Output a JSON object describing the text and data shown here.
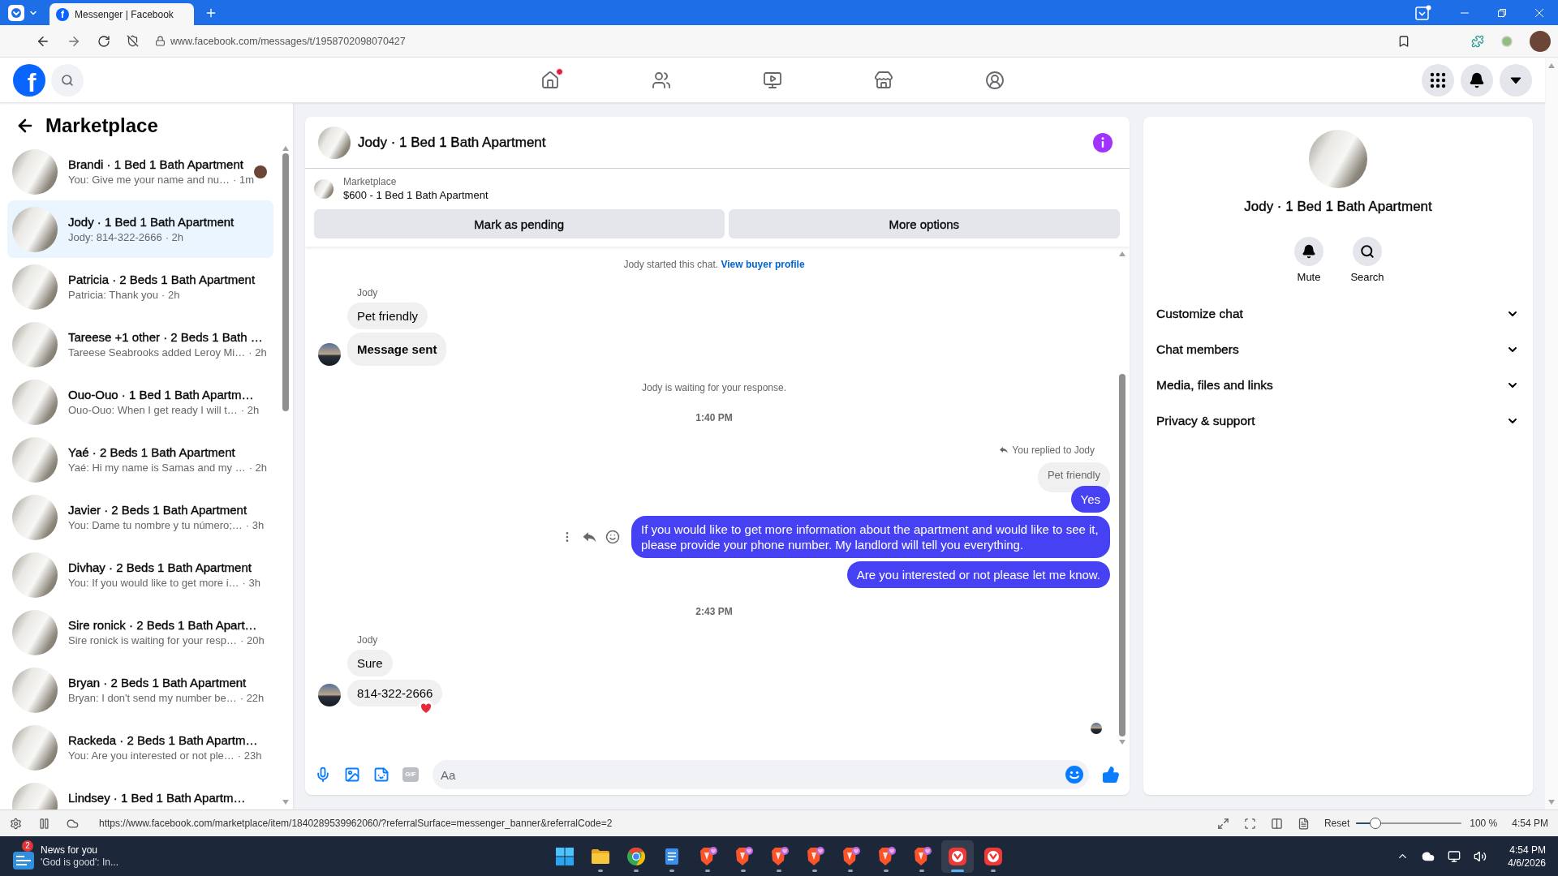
{
  "browser": {
    "tabs": [
      {
        "favicon": "f",
        "title": "Messenger | Facebook",
        "selected": true
      }
    ],
    "url": "www.facebook.com/messages/t/1958702098070427"
  },
  "header": {
    "logo": "f",
    "nav": [
      {
        "kind": "home",
        "selected": false,
        "notification": true
      },
      {
        "kind": "friends",
        "selected": false,
        "notification": false
      },
      {
        "kind": "video",
        "selected": false,
        "notification": false
      },
      {
        "kind": "marketplace",
        "selected": false,
        "notification": false
      },
      {
        "kind": "groups",
        "selected": false,
        "notification": false
      }
    ],
    "actions": [
      {
        "kind": "menu"
      },
      {
        "kind": "notifications"
      },
      {
        "kind": "account"
      }
    ]
  },
  "sidebar": {
    "title": "Marketplace",
    "conversations": [
      {
        "title": "Brandi · 1 Bed 1 Bath Apartment",
        "preview": "You: Give me your name and nu…",
        "time": "· 1m",
        "selected": false,
        "seen": true
      },
      {
        "title": "Jody · 1 Bed 1 Bath Apartment",
        "preview": "Jody: 814-322-2666",
        "time": "· 2h",
        "selected": true,
        "seen": false
      },
      {
        "title": "Patricia · 2 Beds 1 Bath Apartment",
        "preview": "Patricia: Thank you",
        "time": "· 2h",
        "selected": false,
        "seen": false
      },
      {
        "title": "Tareese +1 other · 2 Beds 1 Bath …",
        "preview": "Tareese Seabrooks added Leroy Mi…",
        "time": "· 2h",
        "selected": false,
        "seen": false
      },
      {
        "title": "Ouo-Ouo · 1 Bed 1 Bath Apartm…",
        "preview": "Ouo-Ouo: When I get ready I will t…",
        "time": "· 2h",
        "selected": false,
        "seen": false
      },
      {
        "title": "Yaé · 2 Beds 1 Bath Apartment",
        "preview": "Yaé: Hi my name is Samas and my …",
        "time": "· 2h",
        "selected": false,
        "seen": false
      },
      {
        "title": "Javier · 2 Beds 1 Bath Apartment",
        "preview": "You: Dame tu nombre y tu número;…",
        "time": "· 3h",
        "selected": false,
        "seen": false
      },
      {
        "title": "Divhay · 2 Beds 1 Bath Apartment",
        "preview": "You: If you would like to get more i…",
        "time": "· 3h",
        "selected": false,
        "seen": false
      },
      {
        "title": "Sire ronick · 2 Beds 1 Bath Apart…",
        "preview": "Sire ronick is waiting for your resp…",
        "time": "· 20h",
        "selected": false,
        "seen": false
      },
      {
        "title": "Bryan · 2 Beds 1 Bath Apartment",
        "preview": "Bryan: I don't send my number be…",
        "time": "· 22h",
        "selected": false,
        "seen": false
      },
      {
        "title": "Rackeda · 2 Beds 1 Bath Apartm…",
        "preview": "You: Are you interested or not ple…",
        "time": "· 23h",
        "selected": false,
        "seen": false
      },
      {
        "title": "Lindsey · 1 Bed 1 Bath Apartm…",
        "selected": false,
        "seen": false
      }
    ]
  },
  "chat": {
    "title": "Jody · 1 Bed 1 Bath Apartment",
    "listing": {
      "source": "Marketplace",
      "name": "$600 - 1 Bed 1 Bath Apartment"
    },
    "buttons": [
      "Mark as pending",
      "More options"
    ],
    "messages": [
      {
        "kind": "notice",
        "text": "Jody started this chat.",
        "link": "View buyer profile"
      },
      {
        "kind": "incoming",
        "sender": "Jody",
        "bubbles": [
          {
            "text": "Pet friendly",
            "bold": false,
            "reaction": false
          },
          {
            "text": "Message sent",
            "bold": true,
            "reaction": false
          }
        ]
      },
      {
        "kind": "notice",
        "text": "Jody is waiting for your response."
      },
      {
        "kind": "time",
        "text": "1:40 PM"
      },
      {
        "kind": "outgoing",
        "reply_label": "You replied to Jody",
        "quote": "Pet friendly",
        "bubbles": [
          {
            "text": "Yes",
            "hover": false
          },
          {
            "text": "If you would like to get more information about the apartment and would like to see it, please provide your phone number. My landlord will tell you everything.",
            "hover": true
          },
          {
            "text": "Are you interested or not please let me know.",
            "hover": false
          }
        ]
      },
      {
        "kind": "time",
        "text": "2:43 PM"
      },
      {
        "kind": "incoming",
        "sender": "Jody",
        "bubbles": [
          {
            "text": "Sure",
            "bold": false,
            "reaction": false
          },
          {
            "text": "814-322-2666",
            "bold": false,
            "reaction": true
          }
        ]
      },
      {
        "kind": "seen"
      }
    ],
    "composer": {
      "tools": [
        {
          "kind": "mic",
          "disabled": false
        },
        {
          "kind": "image",
          "disabled": false
        },
        {
          "kind": "sticker",
          "disabled": false
        },
        {
          "kind": "gif",
          "label": "GIF",
          "disabled": true
        }
      ],
      "placeholder": "Aa"
    }
  },
  "details": {
    "title": "Jody · 1 Bed 1 Bath Apartment",
    "actions": [
      {
        "kind": "mute",
        "label": "Mute"
      },
      {
        "kind": "search",
        "label": "Search"
      }
    ],
    "sections": [
      {
        "label": "Customize chat",
        "expanded": false
      },
      {
        "label": "Chat members",
        "expanded": false
      },
      {
        "label": "Media, files and links",
        "expanded": false
      },
      {
        "label": "Privacy & support",
        "expanded": false
      }
    ]
  },
  "status_bar": {
    "link": "https://www.facebook.com/marketplace/item/1840289539962060/?referralSurface=messenger_banner&referralCode=2",
    "reset": "Reset",
    "zoom": {
      "level": 0.18,
      "reading": "100 %"
    },
    "clock": "4:54 PM"
  },
  "taskbar": {
    "news": {
      "badge": "2",
      "title": "News for you",
      "subtitle": "'God is good': In..."
    },
    "apps": [
      {
        "kind": "start",
        "running": false,
        "selected": false
      },
      {
        "kind": "files",
        "running": true,
        "selected": false
      },
      {
        "kind": "browser-round",
        "running": true,
        "selected": false
      },
      {
        "kind": "notepad",
        "running": true,
        "selected": false
      },
      {
        "kind": "browser-shield",
        "running": true,
        "selected": false
      },
      {
        "kind": "browser-shield",
        "running": true,
        "selected": false
      },
      {
        "kind": "browser-shield",
        "running": true,
        "selected": false
      },
      {
        "kind": "browser-shield",
        "running": true,
        "selected": false
      },
      {
        "kind": "browser-shield",
        "running": true,
        "selected": false
      },
      {
        "kind": "browser-shield",
        "running": true,
        "selected": false
      },
      {
        "kind": "browser-shield",
        "running": true,
        "selected": false
      },
      {
        "kind": "browser-red",
        "running": true,
        "selected": true
      },
      {
        "kind": "browser-red",
        "running": true,
        "selected": false
      }
    ],
    "time": "4:54 PM",
    "date": "4/6/2026"
  }
}
